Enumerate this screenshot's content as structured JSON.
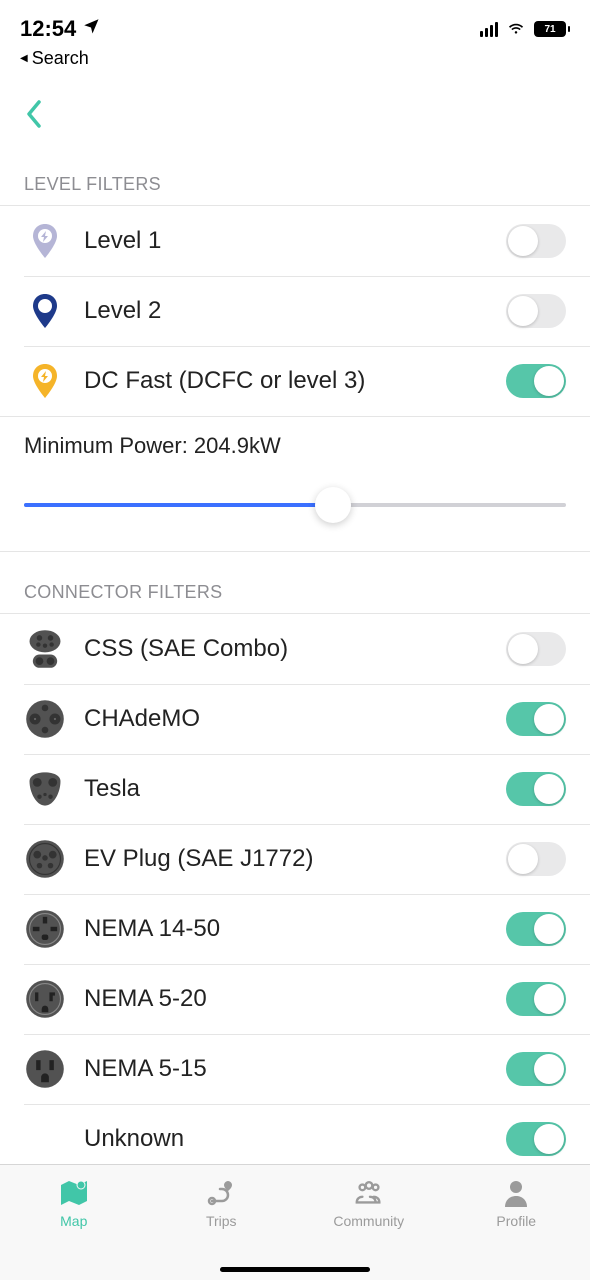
{
  "status": {
    "time": "12:54",
    "battery": "71",
    "back_label": "Search"
  },
  "levels": {
    "header": "LEVEL FILTERS",
    "items": [
      {
        "label": "Level 1",
        "on": false,
        "color": "#b5b5d6",
        "icon": "bolt"
      },
      {
        "label": "Level 2",
        "on": false,
        "color": "#1e3a8a",
        "icon": "plain"
      },
      {
        "label": "DC Fast (DCFC or level 3)",
        "on": true,
        "color": "#f5b429",
        "icon": "bolt"
      }
    ]
  },
  "slider": {
    "label_prefix": "Minimum Power: ",
    "value": "204.9kW",
    "percent": 57
  },
  "connectors": {
    "header": "CONNECTOR FILTERS",
    "items": [
      {
        "label": "CSS (SAE Combo)",
        "on": false
      },
      {
        "label": "CHAdeMO",
        "on": true
      },
      {
        "label": "Tesla",
        "on": true
      },
      {
        "label": "EV Plug (SAE J1772)",
        "on": false
      },
      {
        "label": "NEMA 14-50",
        "on": true
      },
      {
        "label": "NEMA 5-20",
        "on": true
      },
      {
        "label": "NEMA 5-15",
        "on": true
      },
      {
        "label": "Unknown",
        "on": true
      }
    ]
  },
  "tabs": {
    "items": [
      {
        "label": "Map",
        "active": true
      },
      {
        "label": "Trips",
        "active": false
      },
      {
        "label": "Community",
        "active": false
      },
      {
        "label": "Profile",
        "active": false
      }
    ]
  }
}
